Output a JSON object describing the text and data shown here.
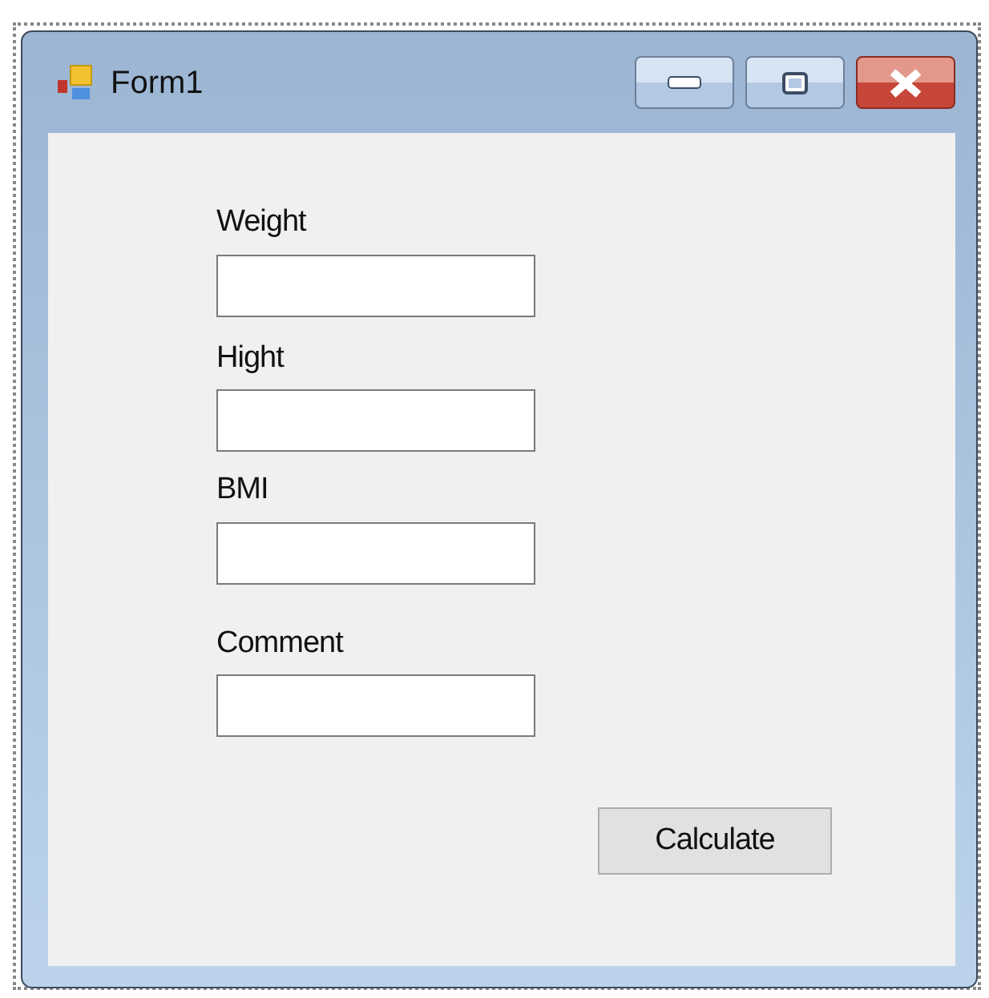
{
  "window": {
    "title": "Form1"
  },
  "fields": [
    {
      "label": "Weight"
    },
    {
      "label": "Hight"
    },
    {
      "label": "BMI"
    },
    {
      "label": "Comment"
    }
  ],
  "buttons": [
    "Calculate"
  ]
}
